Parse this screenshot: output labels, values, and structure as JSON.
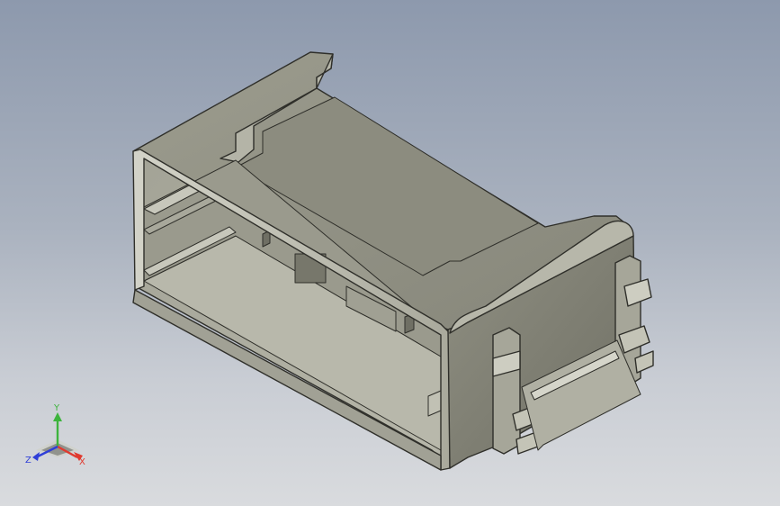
{
  "viewport": {
    "background_top": "#8d99ad",
    "background_bottom": "#d9dbde"
  },
  "model": {
    "body_color": "#8a8a7c",
    "edge_color": "#2f2f2a"
  },
  "triad": {
    "x_label": "X",
    "y_label": "Y",
    "z_label": "Z",
    "x_color": "#e03a2f",
    "y_color": "#3db43d",
    "z_color": "#2f3fd8"
  }
}
